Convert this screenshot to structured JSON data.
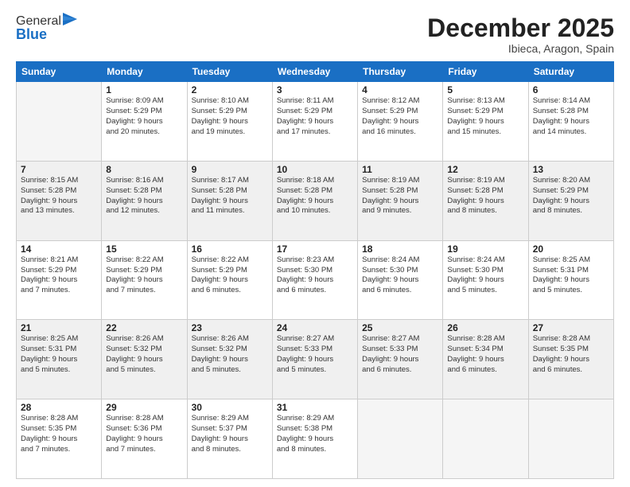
{
  "logo": {
    "general": "General",
    "blue": "Blue"
  },
  "header": {
    "month": "December 2025",
    "location": "Ibieca, Aragon, Spain"
  },
  "days_of_week": [
    "Sunday",
    "Monday",
    "Tuesday",
    "Wednesday",
    "Thursday",
    "Friday",
    "Saturday"
  ],
  "weeks": [
    [
      {
        "day": "",
        "info": ""
      },
      {
        "day": "1",
        "info": "Sunrise: 8:09 AM\nSunset: 5:29 PM\nDaylight: 9 hours\nand 20 minutes."
      },
      {
        "day": "2",
        "info": "Sunrise: 8:10 AM\nSunset: 5:29 PM\nDaylight: 9 hours\nand 19 minutes."
      },
      {
        "day": "3",
        "info": "Sunrise: 8:11 AM\nSunset: 5:29 PM\nDaylight: 9 hours\nand 17 minutes."
      },
      {
        "day": "4",
        "info": "Sunrise: 8:12 AM\nSunset: 5:29 PM\nDaylight: 9 hours\nand 16 minutes."
      },
      {
        "day": "5",
        "info": "Sunrise: 8:13 AM\nSunset: 5:29 PM\nDaylight: 9 hours\nand 15 minutes."
      },
      {
        "day": "6",
        "info": "Sunrise: 8:14 AM\nSunset: 5:28 PM\nDaylight: 9 hours\nand 14 minutes."
      }
    ],
    [
      {
        "day": "7",
        "info": "Sunrise: 8:15 AM\nSunset: 5:28 PM\nDaylight: 9 hours\nand 13 minutes."
      },
      {
        "day": "8",
        "info": "Sunrise: 8:16 AM\nSunset: 5:28 PM\nDaylight: 9 hours\nand 12 minutes."
      },
      {
        "day": "9",
        "info": "Sunrise: 8:17 AM\nSunset: 5:28 PM\nDaylight: 9 hours\nand 11 minutes."
      },
      {
        "day": "10",
        "info": "Sunrise: 8:18 AM\nSunset: 5:28 PM\nDaylight: 9 hours\nand 10 minutes."
      },
      {
        "day": "11",
        "info": "Sunrise: 8:19 AM\nSunset: 5:28 PM\nDaylight: 9 hours\nand 9 minutes."
      },
      {
        "day": "12",
        "info": "Sunrise: 8:19 AM\nSunset: 5:28 PM\nDaylight: 9 hours\nand 8 minutes."
      },
      {
        "day": "13",
        "info": "Sunrise: 8:20 AM\nSunset: 5:29 PM\nDaylight: 9 hours\nand 8 minutes."
      }
    ],
    [
      {
        "day": "14",
        "info": "Sunrise: 8:21 AM\nSunset: 5:29 PM\nDaylight: 9 hours\nand 7 minutes."
      },
      {
        "day": "15",
        "info": "Sunrise: 8:22 AM\nSunset: 5:29 PM\nDaylight: 9 hours\nand 7 minutes."
      },
      {
        "day": "16",
        "info": "Sunrise: 8:22 AM\nSunset: 5:29 PM\nDaylight: 9 hours\nand 6 minutes."
      },
      {
        "day": "17",
        "info": "Sunrise: 8:23 AM\nSunset: 5:30 PM\nDaylight: 9 hours\nand 6 minutes."
      },
      {
        "day": "18",
        "info": "Sunrise: 8:24 AM\nSunset: 5:30 PM\nDaylight: 9 hours\nand 6 minutes."
      },
      {
        "day": "19",
        "info": "Sunrise: 8:24 AM\nSunset: 5:30 PM\nDaylight: 9 hours\nand 5 minutes."
      },
      {
        "day": "20",
        "info": "Sunrise: 8:25 AM\nSunset: 5:31 PM\nDaylight: 9 hours\nand 5 minutes."
      }
    ],
    [
      {
        "day": "21",
        "info": "Sunrise: 8:25 AM\nSunset: 5:31 PM\nDaylight: 9 hours\nand 5 minutes."
      },
      {
        "day": "22",
        "info": "Sunrise: 8:26 AM\nSunset: 5:32 PM\nDaylight: 9 hours\nand 5 minutes."
      },
      {
        "day": "23",
        "info": "Sunrise: 8:26 AM\nSunset: 5:32 PM\nDaylight: 9 hours\nand 5 minutes."
      },
      {
        "day": "24",
        "info": "Sunrise: 8:27 AM\nSunset: 5:33 PM\nDaylight: 9 hours\nand 5 minutes."
      },
      {
        "day": "25",
        "info": "Sunrise: 8:27 AM\nSunset: 5:33 PM\nDaylight: 9 hours\nand 6 minutes."
      },
      {
        "day": "26",
        "info": "Sunrise: 8:28 AM\nSunset: 5:34 PM\nDaylight: 9 hours\nand 6 minutes."
      },
      {
        "day": "27",
        "info": "Sunrise: 8:28 AM\nSunset: 5:35 PM\nDaylight: 9 hours\nand 6 minutes."
      }
    ],
    [
      {
        "day": "28",
        "info": "Sunrise: 8:28 AM\nSunset: 5:35 PM\nDaylight: 9 hours\nand 7 minutes."
      },
      {
        "day": "29",
        "info": "Sunrise: 8:28 AM\nSunset: 5:36 PM\nDaylight: 9 hours\nand 7 minutes."
      },
      {
        "day": "30",
        "info": "Sunrise: 8:29 AM\nSunset: 5:37 PM\nDaylight: 9 hours\nand 8 minutes."
      },
      {
        "day": "31",
        "info": "Sunrise: 8:29 AM\nSunset: 5:38 PM\nDaylight: 9 hours\nand 8 minutes."
      },
      {
        "day": "",
        "info": ""
      },
      {
        "day": "",
        "info": ""
      },
      {
        "day": "",
        "info": ""
      }
    ]
  ]
}
